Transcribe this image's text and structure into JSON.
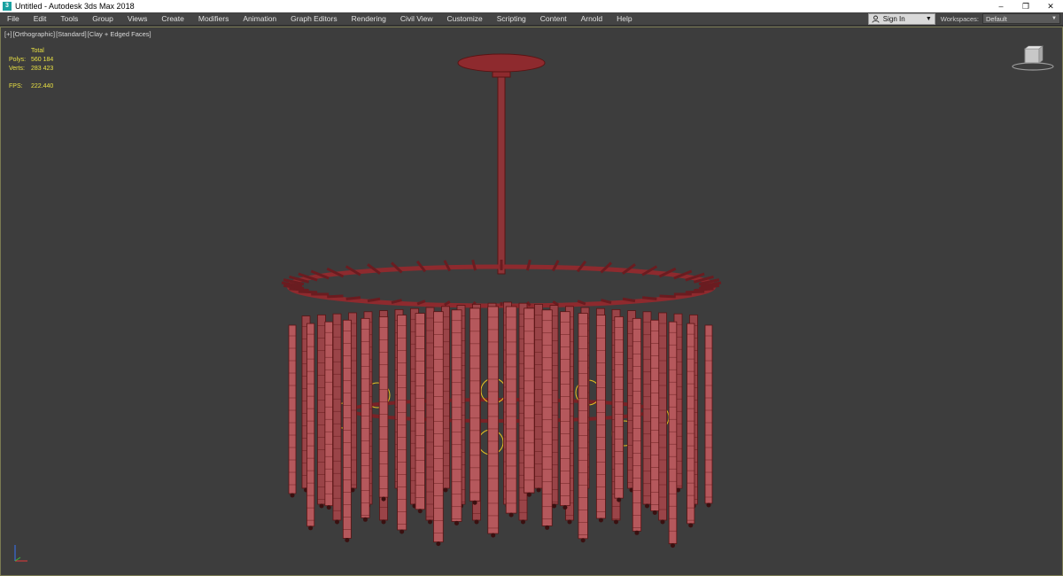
{
  "window": {
    "title": "Untitled - Autodesk 3ds Max 2018",
    "app_icon_letter": "3"
  },
  "menu": {
    "items": [
      "File",
      "Edit",
      "Tools",
      "Group",
      "Views",
      "Create",
      "Modifiers",
      "Animation",
      "Graph Editors",
      "Rendering",
      "Civil View",
      "Customize",
      "Scripting",
      "Content",
      "Arnold",
      "Help"
    ],
    "sign_in": "Sign In",
    "workspaces_label": "Workspaces:",
    "workspace_value": "Default"
  },
  "viewport": {
    "labels": [
      "[+]",
      "[Orthographic]",
      "[Standard]",
      "[Clay + Edged Faces]"
    ],
    "stats": {
      "total_label": "Total",
      "polys_label": "Polys:",
      "polys_value": "560 184",
      "verts_label": "Verts:",
      "verts_value": "283 423",
      "fps_label": "FPS:",
      "fps_value": "222.440"
    }
  },
  "colors": {
    "viewport_bg": "#3d3d3d",
    "model": "#b5585c",
    "wire": "#5a1414",
    "stats_text": "#e8e043",
    "light_helper": "#e8c020"
  },
  "icons": [
    "app-icon",
    "minimize-icon",
    "restore-icon",
    "close-icon",
    "user-icon",
    "viewcube-icon",
    "axis-tripod-icon"
  ]
}
